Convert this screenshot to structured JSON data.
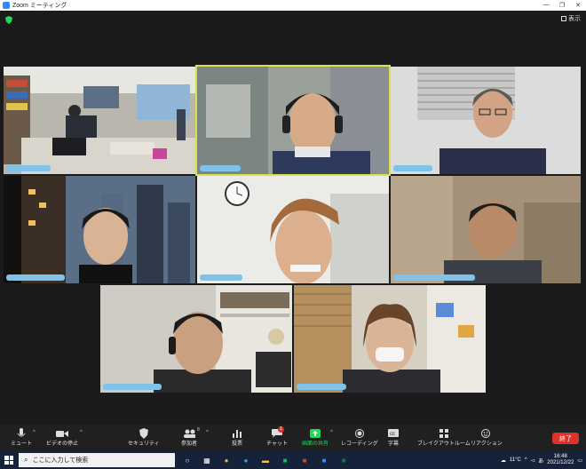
{
  "window": {
    "title": "Zoom ミーティング",
    "view_label": "表示"
  },
  "toolbar": {
    "mute": "ミュート",
    "video": "ビデオの停止",
    "security": "セキュリティ",
    "participants": "参加者",
    "participants_count": "8",
    "polls": "投票",
    "chat": "チャット",
    "chat_badge": "1",
    "share": "画面の共有",
    "record": "レコーディング",
    "captions": "字幕",
    "breakout": "ブレイクアウトルーム",
    "reactions": "リアクション",
    "end": "終了"
  },
  "taskbar": {
    "search_placeholder": "ここに入力して検索",
    "weather": "11°C",
    "ime": "あ",
    "time": "16:48",
    "date": "2021/12/22"
  },
  "colors": {
    "active_speaker": "#d8e04a",
    "end": "#e0302a",
    "share": "#23d959",
    "name_tag": "#7fc3ea"
  }
}
